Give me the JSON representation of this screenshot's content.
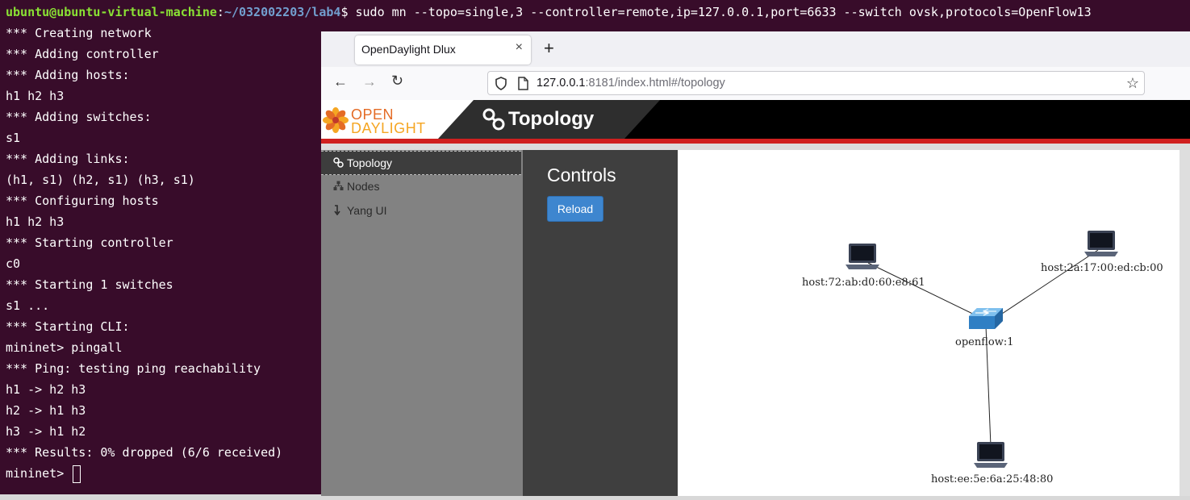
{
  "terminal": {
    "prompt_user": "ubuntu@ubuntu-virtual-machine",
    "prompt_sep": ":",
    "prompt_path": "~/032002203/lab4",
    "prompt_symbol": "$",
    "command": " sudo mn --topo=single,3 --controller=remote,ip=127.0.0.1,port=6633 --switch ovsk,protocols=OpenFlow13",
    "lines": [
      "*** Creating network",
      "*** Adding controller",
      "*** Adding hosts:",
      "h1 h2 h3",
      "*** Adding switches:",
      "s1",
      "*** Adding links:",
      "(h1, s1) (h2, s1) (h3, s1)",
      "*** Configuring hosts",
      "h1 h2 h3",
      "*** Starting controller",
      "c0",
      "*** Starting 1 switches",
      "s1 ...",
      "*** Starting CLI:",
      "mininet> pingall",
      "*** Ping: testing ping reachability",
      "h1 -> h2 h3",
      "h2 -> h1 h3",
      "h3 -> h1 h2",
      "*** Results: 0% dropped (6/6 received)"
    ],
    "final_prompt": "mininet> ",
    "colors": {
      "background": "#380c2a",
      "user": "#8ae234",
      "path": "#729fcf"
    }
  },
  "browser": {
    "tab_title": "OpenDaylight Dlux",
    "close_glyph": "×",
    "new_tab_glyph": "+",
    "back_glyph": "←",
    "forward_glyph": "→",
    "reload_glyph": "↻",
    "star_glyph": "☆",
    "url_host": "127.0.0.1",
    "url_rest": ":8181/index.html#/topology"
  },
  "odl": {
    "logo_open": "OPEN",
    "logo_daylight": "DAYLIGHT",
    "header_title": "Topology",
    "header_icon": "topology-icon",
    "sidebar": [
      {
        "label": "Topology",
        "icon": "topology-icon",
        "active": true
      },
      {
        "label": "Nodes",
        "icon": "nodes-icon",
        "active": false
      },
      {
        "label": "Yang UI",
        "icon": "yang-arrow-icon",
        "active": false
      }
    ],
    "controls_title": "Controls",
    "reload_label": "Reload",
    "colors": {
      "header": "#000000",
      "stripe": "#d0201f",
      "button": "#3e86cf"
    }
  },
  "topology": {
    "switch": {
      "label": "openflow:1",
      "icon": "switch-icon"
    },
    "hosts": [
      {
        "label": "host:72:ab:d0:60:e8:61",
        "icon": "laptop-icon"
      },
      {
        "label": "host:2a:17:00:ed:cb:00",
        "icon": "laptop-icon"
      },
      {
        "label": "host:ee:5e:6a:25:48:80",
        "icon": "laptop-icon"
      }
    ]
  }
}
